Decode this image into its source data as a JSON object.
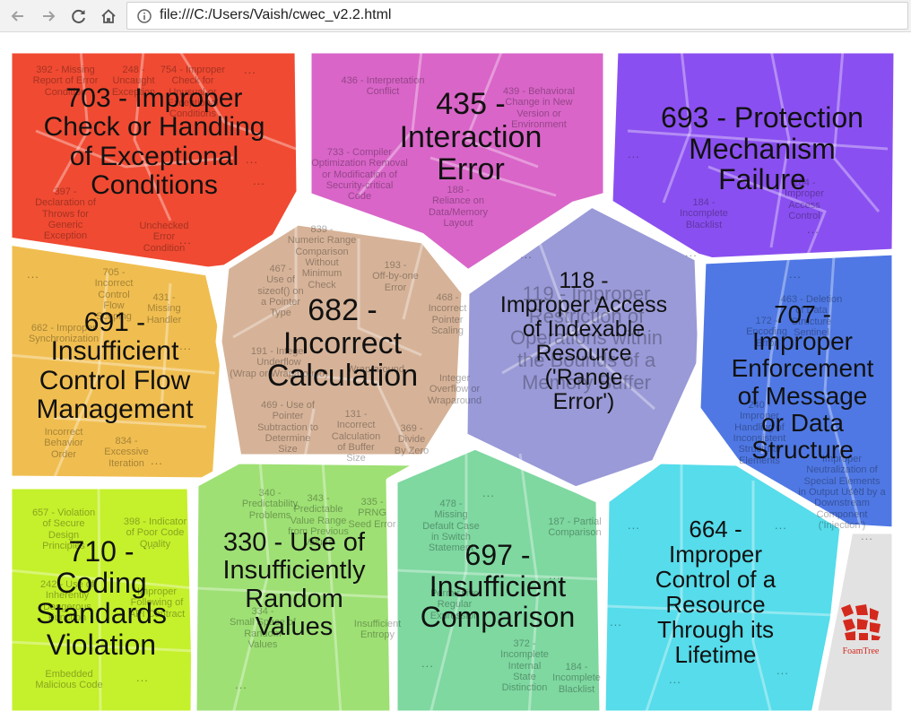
{
  "browser": {
    "url": "file:///C:/Users/Vaish/cwec_v2.2.html",
    "icons": [
      "back-arrow-icon",
      "forward-arrow-icon",
      "reload-icon",
      "home-icon",
      "info-icon"
    ]
  },
  "visualization": {
    "groups": [
      {
        "id": "g703",
        "label": "703 - Improper\nCheck or Handling\nof Exceptional\nConditions",
        "color": "#f04a32",
        "children": [
          "392 - Missing\nReport of Error\nCondition",
          "248 -\nUncaught\nException",
          "754 - Improper\nCheck for\nUnusual or\nExceptional\nConditions",
          "397 -\nDeclaration of\nThrows for\nGeneric\nException",
          "Unchecked\nError\nCondition"
        ]
      },
      {
        "id": "g435",
        "label": "435 -\nInteraction\nError",
        "color": "#d965c8",
        "children": [
          "436 - Interpretation\nConflict",
          "439 - Behavioral\nChange in New\nVersion or\nEnvironment",
          "733 - Compiler\nOptimization Removal\nor Modification of\nSecurity-critical\nCode",
          "188 -\nReliance on\nData/Memory\nLayout"
        ]
      },
      {
        "id": "g693",
        "label": "693 - Protection\nMechanism\nFailure",
        "color": "#8a4ff0",
        "children": [
          "184 -\nIncomplete\nBlacklist",
          "284 -\nImproper\nAccess\nControl"
        ]
      },
      {
        "id": "g691",
        "label": "691 -\nInsufficient\nControl Flow\nManagement",
        "color": "#f0be50",
        "children": [
          "705 -\nIncorrect\nControl\nFlow\nScoping",
          "431 -\nMissing\nHandler",
          "662 - Improper\nSynchronization",
          "834 -\nExcessive\nIteration",
          "Incorrect\nBehavior\nOrder"
        ]
      },
      {
        "id": "g682",
        "label": "682 -\nIncorrect\nCalculation",
        "color": "#d6b398",
        "children": [
          "839 -\nNumeric Range\nComparison\nWithout\nMinimum\nCheck",
          "467 -\nUse of\nsizeof() on\na Pointer\nType",
          "193 -\nOff-by-one\nError",
          "468 -\nIncorrect\nPointer\nScaling",
          "191 - Integer\nUnderflow\n(Wrap or Wraparound)",
          "469 - Use of\nPointer\nSubtraction to\nDetermine\nSize",
          "131 -\nIncorrect\nCalculation\nof Buffer\nSize",
          "369 -\nDivide\nBy Zero",
          "Wrap-around",
          "Integer\nOverflow or\nWraparound"
        ]
      },
      {
        "id": "g118",
        "label": "118 -\nImproper Access\nof Indexable\nResource\n('Range\nError')",
        "color": "#9a9ad8",
        "children": [
          "119 - Improper\nRestriction of\nOperations within\nthe Bounds of a\nMemory Buffer"
        ]
      },
      {
        "id": "g707",
        "label": "707 -\nImproper\nEnforcement\nof Message\nor Data\nStructure",
        "color": "#4f78e4",
        "children": [
          "463 - Deletion\nof Data\nStructure\nSentinel",
          "172 -\nEncoding\nError",
          "240 -\nImproper\nHandling of\nInconsistent\nStructural\nElements",
          "Improper\nNeutralization of\nSpecial Elements\nin Output Used by a\nDownstream\nComponent\n('Injection')"
        ]
      },
      {
        "id": "g710",
        "label": "710 -\nCoding\nStandards\nViolation",
        "color": "#c5f02c",
        "children": [
          "657 - Violation\nof Secure\nDesign\nPrinciples",
          "398 - Indicator\nof Poor Code\nQuality",
          "242 - Use of\nInherently\nDangerous\nFunction",
          "Improper\nFollowing of\nAPI Contract",
          "Embedded\nMalicious Code"
        ]
      },
      {
        "id": "g330",
        "label": "330 - Use of\nInsufficiently\nRandom\nValues",
        "color": "#9ee074",
        "children": [
          "340 -\nPredictability\nProblems",
          "343 -\nPredictable\nValue Range\nfrom Previous\nValues",
          "335 -\nPRNG\nSeed Error",
          "334 -\nSmall Space of\nRandom\nValues",
          "Insufficient\nEntropy"
        ]
      },
      {
        "id": "g697",
        "label": "697 -\nInsufficient\nComparison",
        "color": "#7ed8a0",
        "children": [
          "478 -\nMissing\nDefault Case\nin Switch\nStatement",
          "187 - Partial\nComparison",
          "Permissive\nRegular\nExpression",
          "372 -\nIncomplete\nInternal\nState\nDistinction",
          "184 -\nIncomplete\nBlacklist"
        ]
      },
      {
        "id": "g664",
        "label": "664 -\nImproper\nControl of a\nResource\nThrough its\nLifetime",
        "color": "#56dcea",
        "children": []
      }
    ],
    "more_indicator": "...",
    "brand": {
      "name": "FoamTree",
      "color": "#d42a1e"
    }
  }
}
